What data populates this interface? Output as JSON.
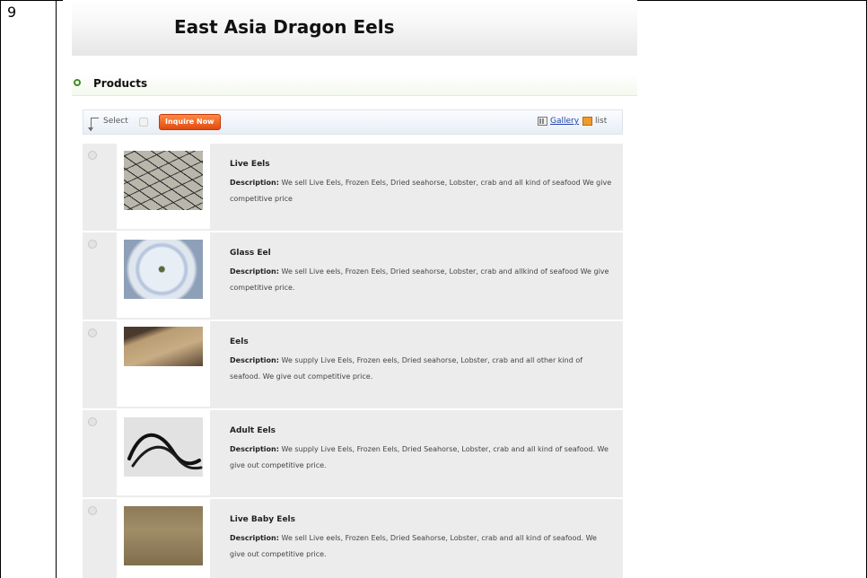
{
  "document": {
    "row_number": "9"
  },
  "store": {
    "title": "East Asia Dragon Eels"
  },
  "section": {
    "heading": "Products"
  },
  "toolbar": {
    "select_label": "Select",
    "inquire_label": "Inquire Now",
    "gallery_label": "Gallery",
    "list_label": "list"
  },
  "products": [
    {
      "name": "Live Eels",
      "desc_label": "Description:",
      "description": "We sell Live Eels, Frozen Eels, Dried seahorse, Lobster, crab and all kind of seafood We give competitive price"
    },
    {
      "name": "Glass Eel",
      "desc_label": "Description:",
      "description": "We sell Live eels, Frozen Eels, Dried seahorse, Lobster, crab and allkind of seafood We give competitive price."
    },
    {
      "name": "Eels",
      "desc_label": "Description:",
      "description": "We supply Live Eels, Frozen eels, Dried seahorse, Lobster, crab and all other kind of seafood. We give out competitive price."
    },
    {
      "name": "Adult Eels",
      "desc_label": "Description:",
      "description": "We supply Live Eels, Frozen Eels, Dried Seahorse, Lobster, crab and all kind of seafood. We give out competitive price."
    },
    {
      "name": "Live Baby Eels",
      "desc_label": "Description:",
      "description": "We sell Live eels, Frozen Eels, Dried Seahorse, Lobster, crab and all kind of seafood. We give out competitive price."
    }
  ]
}
